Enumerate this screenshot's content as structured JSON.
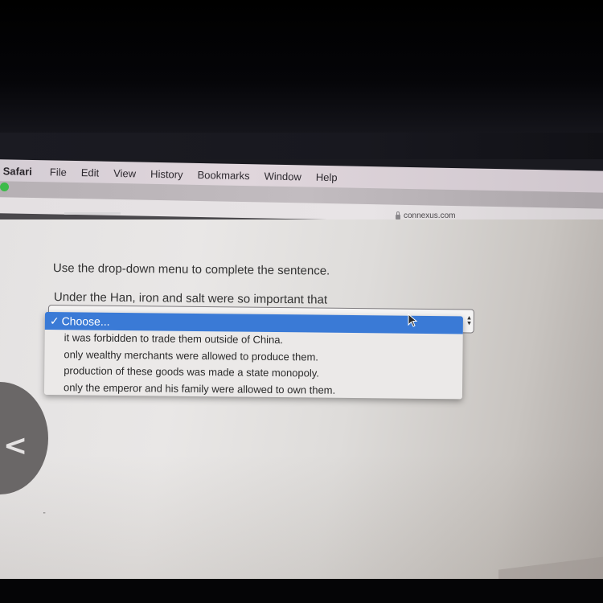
{
  "menubar": {
    "app": "Safari",
    "items": [
      "File",
      "Edit",
      "View",
      "History",
      "Bookmarks",
      "Window",
      "Help"
    ]
  },
  "browser": {
    "url": "connexus.com",
    "lock_icon": "lock-icon"
  },
  "page": {
    "instruction": "Use the drop-down menu to complete the sentence.",
    "prompt": "Under the Han, iron and salt were so important that",
    "back_icon": "chevron-left-icon",
    "tiny_mark": "\""
  },
  "dropdown": {
    "selected_check": "✓",
    "selected": "Choose...",
    "options": [
      "it was forbidden to trade them outside of China.",
      "only wealthy merchants were allowed to produce them.",
      "production of these goods was made a state monopoly.",
      "only the emperor and his family were allowed to own them."
    ],
    "highlight_color": "#3a7ad6"
  }
}
